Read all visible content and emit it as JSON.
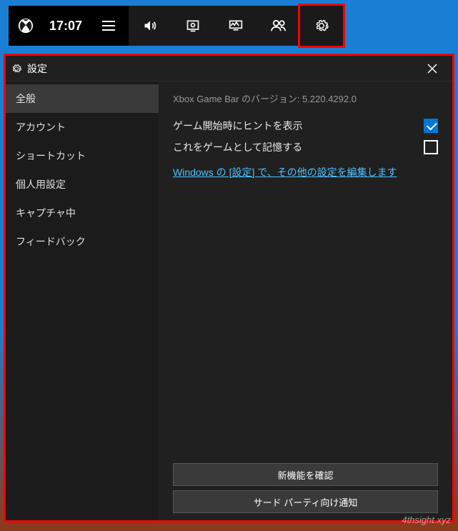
{
  "topbar": {
    "time": "17:07",
    "icons": {
      "xbox": "xbox-logo-icon",
      "menu": "menu-lines-icon",
      "audio": "speaker-icon",
      "capture": "capture-icon",
      "performance": "performance-icon",
      "social": "people-icon",
      "settings": "gear-icon"
    }
  },
  "window": {
    "title": "設定",
    "close": "✕"
  },
  "sidebar": {
    "items": [
      {
        "label": "全般",
        "selected": true
      },
      {
        "label": "アカウント",
        "selected": false
      },
      {
        "label": "ショートカット",
        "selected": false
      },
      {
        "label": "個人用設定",
        "selected": false
      },
      {
        "label": "キャプチャ中",
        "selected": false
      },
      {
        "label": "フィードバック",
        "selected": false
      }
    ]
  },
  "content": {
    "version_label": "Xbox Game Bar のバージョン: 5.220.4292.0",
    "option_hint_label": "ゲーム開始時にヒントを表示",
    "option_hint_checked": true,
    "option_remember_label": "これをゲームとして記憶する",
    "option_remember_checked": false,
    "settings_link": "Windows の [設定] で、その他の設定を編集します",
    "buttons": {
      "whats_new": "新機能を確認",
      "third_party": "サード パーティ向け通知"
    }
  },
  "watermark": "4thsight.xyz"
}
